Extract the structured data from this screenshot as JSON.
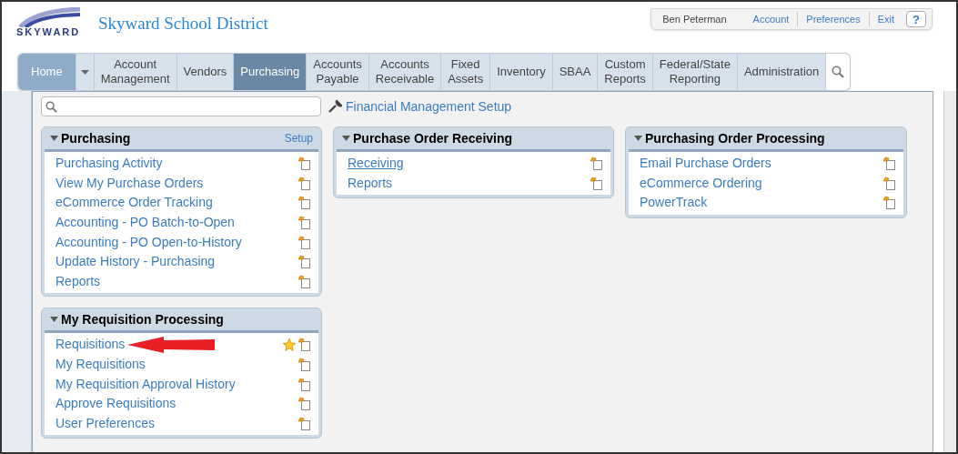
{
  "header": {
    "title": "Skyward School District",
    "logo_text": "SKYWARD"
  },
  "user_bar": {
    "user": "Ben Peterman",
    "links": [
      "Account",
      "Preferences",
      "Exit"
    ],
    "help": "?"
  },
  "tabs": [
    {
      "label": "Home",
      "kind": "home",
      "selected": false
    },
    {
      "label": "Account\nManagement",
      "kind": "tab",
      "selected": false
    },
    {
      "label": "Vendors",
      "kind": "tab",
      "selected": false
    },
    {
      "label": "Purchasing",
      "kind": "tab",
      "selected": true
    },
    {
      "label": "Accounts\nPayable",
      "kind": "tab",
      "selected": false
    },
    {
      "label": "Accounts\nReceivable",
      "kind": "tab",
      "selected": false
    },
    {
      "label": "Fixed\nAssets",
      "kind": "tab",
      "selected": false
    },
    {
      "label": "Inventory",
      "kind": "tab",
      "selected": false
    },
    {
      "label": "SBAA",
      "kind": "tab",
      "selected": false
    },
    {
      "label": "Custom\nReports",
      "kind": "tab",
      "selected": false
    },
    {
      "label": "Federal/State\nReporting",
      "kind": "tab",
      "selected": false
    },
    {
      "label": "Administration",
      "kind": "tab",
      "selected": false
    }
  ],
  "setup_link": "Financial Management Setup",
  "columns": [
    [
      {
        "title": "Purchasing",
        "expanded": true,
        "setup": "Setup",
        "items": [
          {
            "label": "Purchasing Activity",
            "favorite": false,
            "hovered": false,
            "arrow": false
          },
          {
            "label": "View My Purchase Orders",
            "favorite": false,
            "hovered": false,
            "arrow": false
          },
          {
            "label": "eCommerce Order Tracking",
            "favorite": false,
            "hovered": false,
            "arrow": false
          },
          {
            "label": "Accounting - PO Batch-to-Open",
            "favorite": false,
            "hovered": false,
            "arrow": false
          },
          {
            "label": "Accounting - PO Open-to-History",
            "favorite": false,
            "hovered": false,
            "arrow": false
          },
          {
            "label": "Update History - Purchasing",
            "favorite": false,
            "hovered": false,
            "arrow": false
          },
          {
            "label": "Reports",
            "favorite": false,
            "hovered": false,
            "arrow": false
          }
        ]
      },
      {
        "title": "My Requisition Processing",
        "expanded": true,
        "items": [
          {
            "label": "Requisitions",
            "favorite": true,
            "hovered": false,
            "arrow": true
          },
          {
            "label": "My Requisitions",
            "favorite": false,
            "hovered": false,
            "arrow": false
          },
          {
            "label": "My Requisition Approval History",
            "favorite": false,
            "hovered": false,
            "arrow": false
          },
          {
            "label": "Approve Requisitions",
            "favorite": false,
            "hovered": false,
            "arrow": false
          },
          {
            "label": "User Preferences",
            "favorite": false,
            "hovered": false,
            "arrow": false
          }
        ]
      }
    ],
    [
      {
        "title": "Purchase Order Receiving",
        "expanded": true,
        "items": [
          {
            "label": "Receiving",
            "favorite": false,
            "hovered": true,
            "arrow": false
          },
          {
            "label": "Reports",
            "favorite": false,
            "hovered": false,
            "arrow": false
          }
        ]
      }
    ],
    [
      {
        "title": "Purchasing Order Processing",
        "expanded": true,
        "items": [
          {
            "label": "Email Purchase Orders",
            "favorite": false,
            "hovered": false,
            "arrow": false
          },
          {
            "label": "eCommerce Ordering",
            "favorite": false,
            "hovered": false,
            "arrow": false
          },
          {
            "label": "PowerTrack",
            "favorite": false,
            "hovered": false,
            "arrow": false
          }
        ]
      }
    ]
  ]
}
